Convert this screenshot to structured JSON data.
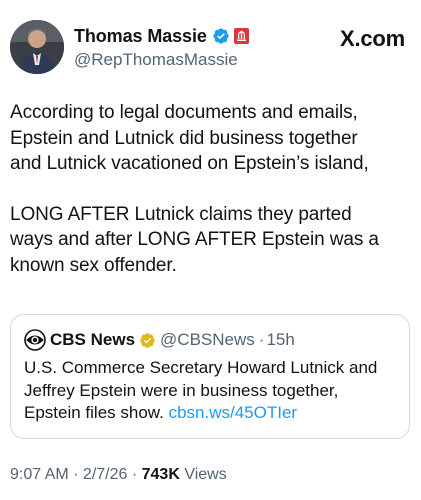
{
  "author": {
    "display_name": "Thomas Massie",
    "handle": "@RepThomasMassie",
    "verified_icon": "blue-verified-badge",
    "affiliation_icon": "us-government-badge"
  },
  "site_label": "X.com",
  "tweet": {
    "paragraph_1": "According to legal documents and emails,\nEpstein and Lutnick did business together\nand Lutnick vacationed on Epstein’s island,",
    "paragraph_2": "LONG AFTER Lutnick claims they parted\nways and after LONG AFTER Epstein was a\nknown sex offender."
  },
  "quote": {
    "logo_icon": "cbs-eye-logo",
    "name": "CBS News",
    "verified_icon": "gold-verified-badge",
    "handle": "@CBSNews",
    "separator": "·",
    "time": "15h",
    "body": "U.S. Commerce Secretary Howard Lutnick and\nJeffrey Epstein were in business together,\nEpstein files show. ",
    "link": "cbsn.ws/45OTIer"
  },
  "meta": {
    "time": "9:07 AM",
    "sep1": " · ",
    "date": "2/7/26",
    "sep2": " · ",
    "views_count": "743K",
    "views_label": " Views"
  },
  "colors": {
    "verified_blue": "#1d9bf0",
    "gold": "#e2b719",
    "gov_red": "#d9363e",
    "secondary_text": "#536471",
    "link": "#1d9bf0"
  }
}
